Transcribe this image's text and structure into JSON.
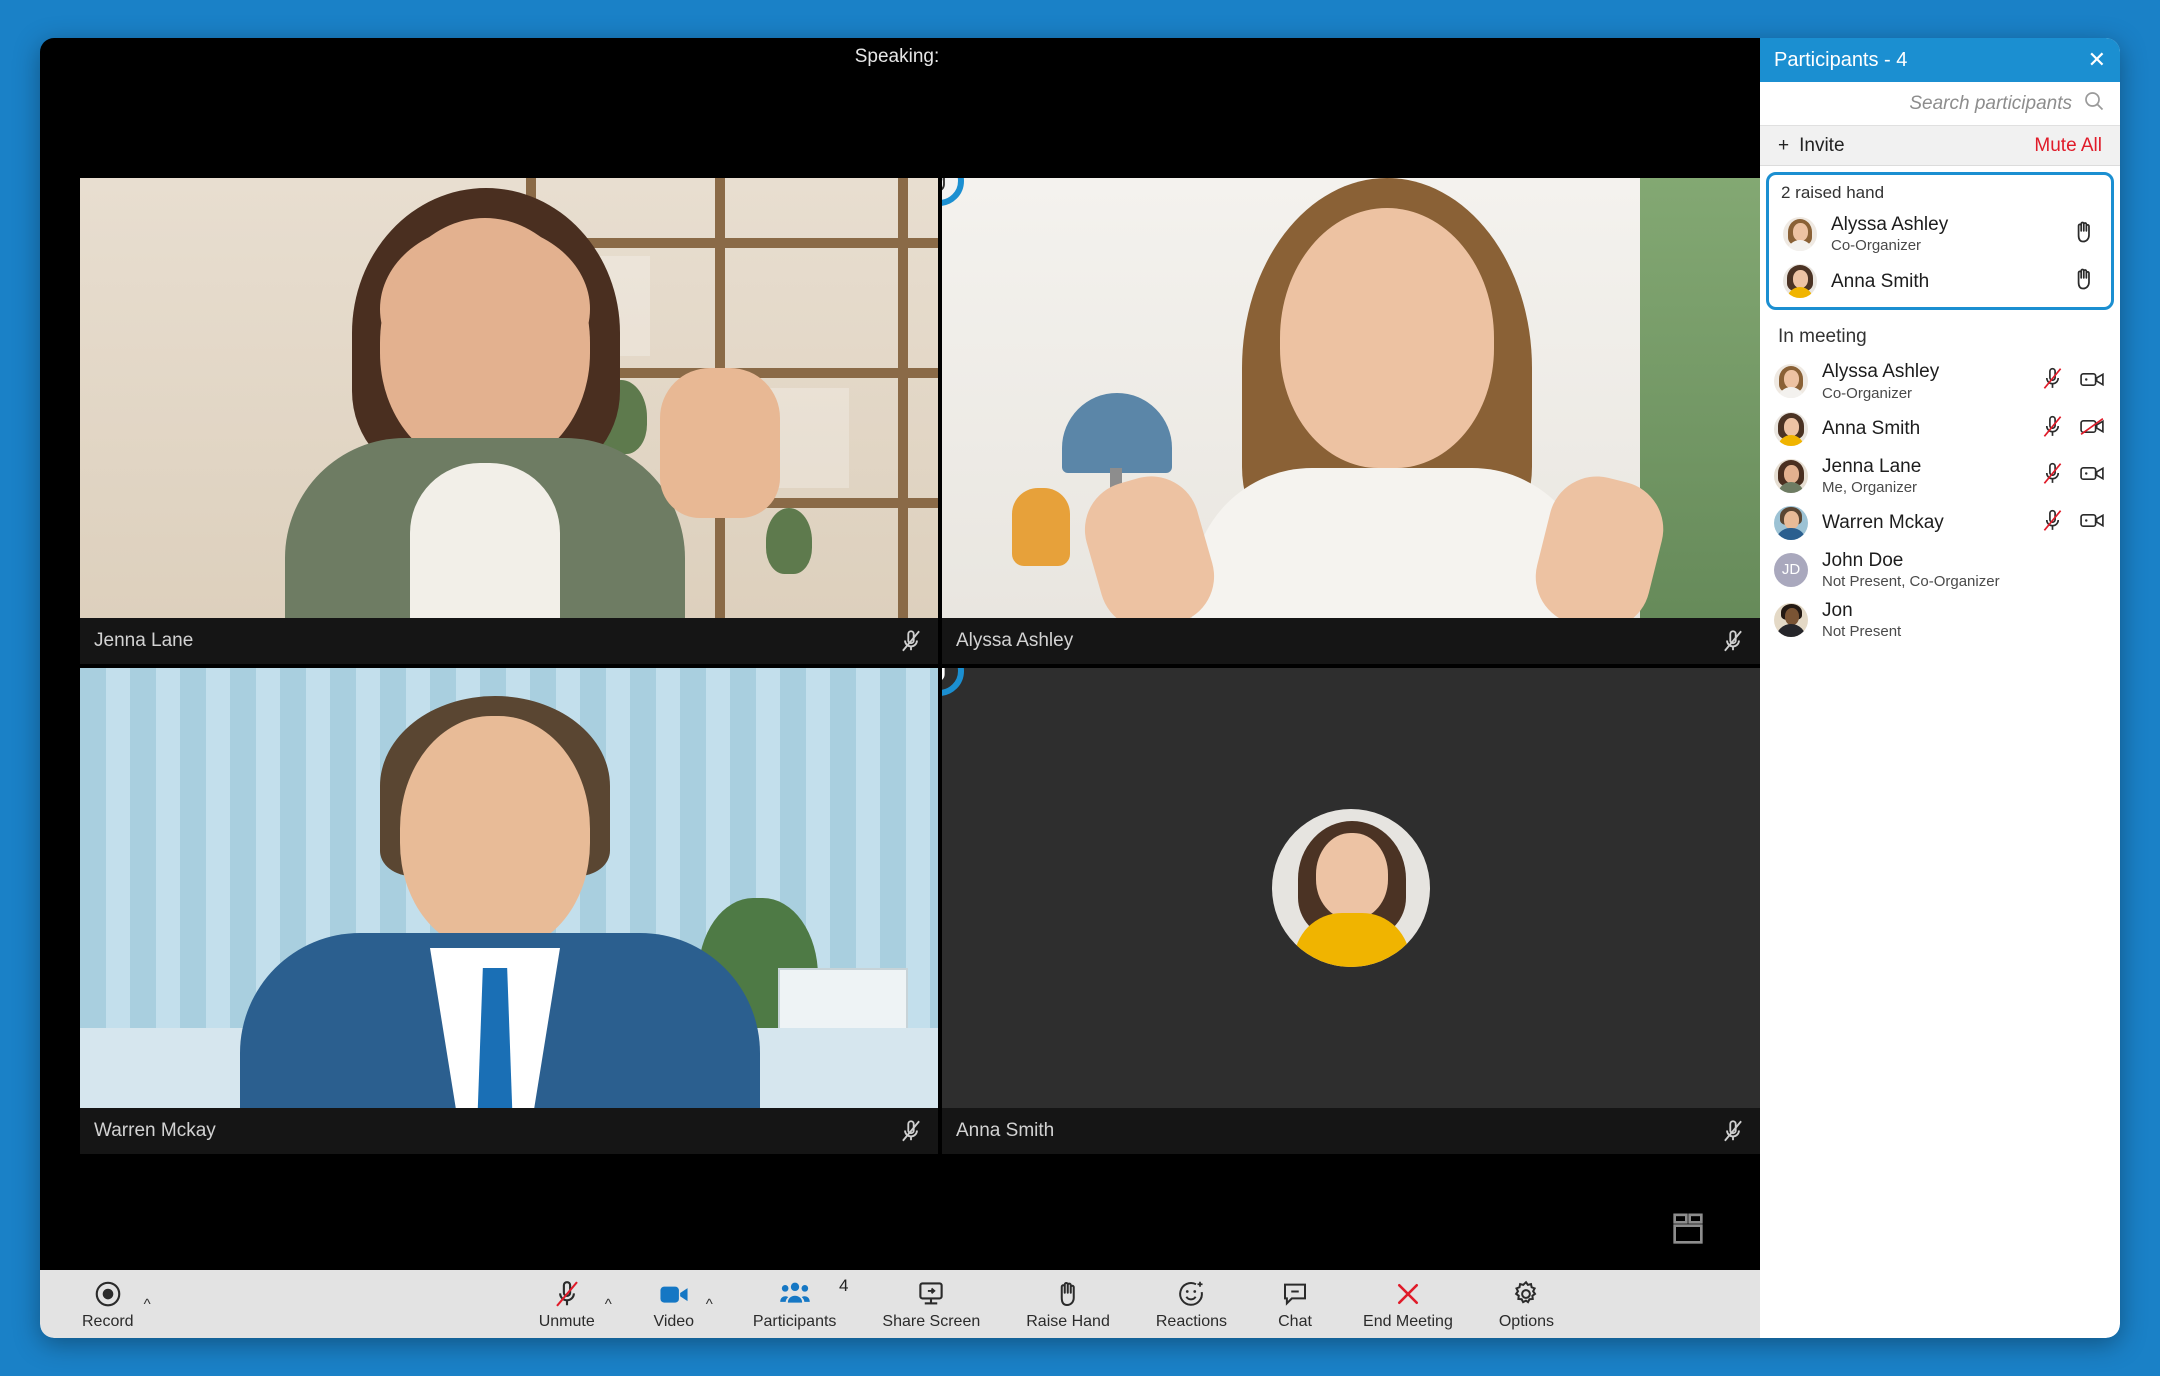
{
  "theme": {
    "accent_blue": "#1b8fd1",
    "page_background": "#1a81c7",
    "danger_red": "#e01b29",
    "toolbar_background": "#e3e3e3",
    "stage_background": "#000000"
  },
  "stage": {
    "speaking_label": "Speaking:",
    "speaking_name": "",
    "layout_icon": "grid-layout-icon",
    "tiles": [
      {
        "name": "Jenna Lane",
        "muted": true,
        "hand_raised": false,
        "video_on": true,
        "position": "top-left"
      },
      {
        "name": "Alyssa Ashley",
        "muted": true,
        "hand_raised": true,
        "video_on": true,
        "position": "top-right"
      },
      {
        "name": "Warren Mckay",
        "muted": true,
        "hand_raised": false,
        "video_on": true,
        "position": "bottom-left"
      },
      {
        "name": "Anna Smith",
        "muted": true,
        "hand_raised": true,
        "video_on": false,
        "position": "bottom-right"
      }
    ]
  },
  "toolbar": {
    "record": {
      "label": "Record",
      "icon": "record-icon",
      "has_chevron": true
    },
    "unmute": {
      "label": "Unmute",
      "icon": "microphone-muted-icon",
      "has_chevron": true
    },
    "video": {
      "label": "Video",
      "icon": "video-camera-icon",
      "has_chevron": true,
      "active": true
    },
    "participants": {
      "label": "Participants",
      "icon": "participants-icon",
      "badge": "4",
      "active": true
    },
    "share_screen": {
      "label": "Share Screen",
      "icon": "share-screen-icon"
    },
    "raise_hand": {
      "label": "Raise Hand",
      "icon": "raised-hand-icon"
    },
    "reactions": {
      "label": "Reactions",
      "icon": "reactions-smiley-icon"
    },
    "chat": {
      "label": "Chat",
      "icon": "chat-bubble-icon"
    },
    "end_meeting": {
      "label": "End Meeting",
      "icon": "close-x-icon"
    },
    "options": {
      "label": "Options",
      "icon": "gear-icon"
    }
  },
  "panel": {
    "title": "Participants - 4",
    "close_icon": "close-icon",
    "search": {
      "placeholder": "Search participants",
      "value": "",
      "icon": "search-icon"
    },
    "invite_label": "Invite",
    "invite_icon": "plus-icon",
    "mute_all_label": "Mute All",
    "raised_section": {
      "title": "2 raised hand",
      "items": [
        {
          "name": "Alyssa Ashley",
          "role": "Co-Organizer",
          "icon": "raised-hand-icon"
        },
        {
          "name": "Anna Smith",
          "role": "",
          "icon": "raised-hand-icon"
        }
      ]
    },
    "in_meeting_section": {
      "title": "In meeting",
      "items": [
        {
          "name": "Alyssa Ashley",
          "role": "Co-Organizer",
          "mic": "microphone-muted-icon",
          "cam": "video-camera-icon",
          "mic_muted": true,
          "cam_off": false,
          "avatar_type": "photo"
        },
        {
          "name": "Anna Smith",
          "role": "",
          "mic": "microphone-muted-icon",
          "cam": "video-camera-off-icon",
          "mic_muted": true,
          "cam_off": true,
          "avatar_type": "photo"
        },
        {
          "name": "Jenna Lane",
          "role": "Me, Organizer",
          "mic": "microphone-muted-icon",
          "cam": "video-camera-icon",
          "mic_muted": true,
          "cam_off": false,
          "avatar_type": "photo"
        },
        {
          "name": "Warren Mckay",
          "role": "",
          "mic": "microphone-muted-icon",
          "cam": "video-camera-icon",
          "mic_muted": true,
          "cam_off": false,
          "avatar_type": "photo"
        },
        {
          "name": "John Doe",
          "role": "Not Present, Co-Organizer",
          "mic": "",
          "cam": "",
          "mic_muted": false,
          "cam_off": false,
          "avatar_type": "initials",
          "initials": "JD"
        },
        {
          "name": "Jon",
          "role": "Not Present",
          "mic": "",
          "cam": "",
          "mic_muted": false,
          "cam_off": false,
          "avatar_type": "photo"
        }
      ]
    }
  }
}
